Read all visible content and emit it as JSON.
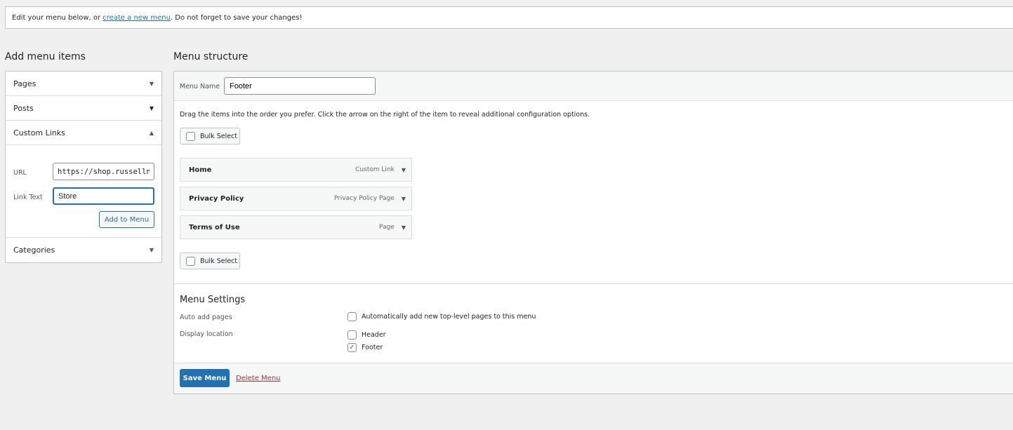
{
  "notice": {
    "prefix": "Edit your menu below, or ",
    "link": "create a new menu",
    "suffix": ". Do not forget to save your changes!"
  },
  "add_items": {
    "heading": "Add menu items",
    "sections": {
      "pages": "Pages",
      "posts": "Posts",
      "custom_links": "Custom Links",
      "categories": "Categories"
    },
    "custom_links": {
      "url_label": "URL",
      "url_value": "https://shop.russelln",
      "link_text_label": "Link Text",
      "link_text_value": "Store",
      "add_button": "Add to Menu"
    }
  },
  "structure": {
    "heading": "Menu structure",
    "menu_name_label": "Menu Name",
    "menu_name_value": "Footer",
    "instructions": "Drag the items into the order you prefer. Click the arrow on the right of the item to reveal additional configuration options.",
    "bulk_select": "Bulk Select",
    "items": [
      {
        "title": "Home",
        "type": "Custom Link"
      },
      {
        "title": "Privacy Policy",
        "type": "Privacy Policy Page"
      },
      {
        "title": "Terms of Use",
        "type": "Page"
      }
    ]
  },
  "settings": {
    "heading": "Menu Settings",
    "auto_add_label": "Auto add pages",
    "auto_add_option": "Automatically add new top-level pages to this menu",
    "display_location_label": "Display location",
    "locations": [
      {
        "label": "Header",
        "checked": false
      },
      {
        "label": "Footer",
        "checked": true
      }
    ]
  },
  "actions": {
    "save": "Save Menu",
    "delete": "Delete Menu"
  },
  "colors": {
    "primary": "#2271b1",
    "danger": "#b32d2e",
    "background": "#f0f0f1"
  }
}
